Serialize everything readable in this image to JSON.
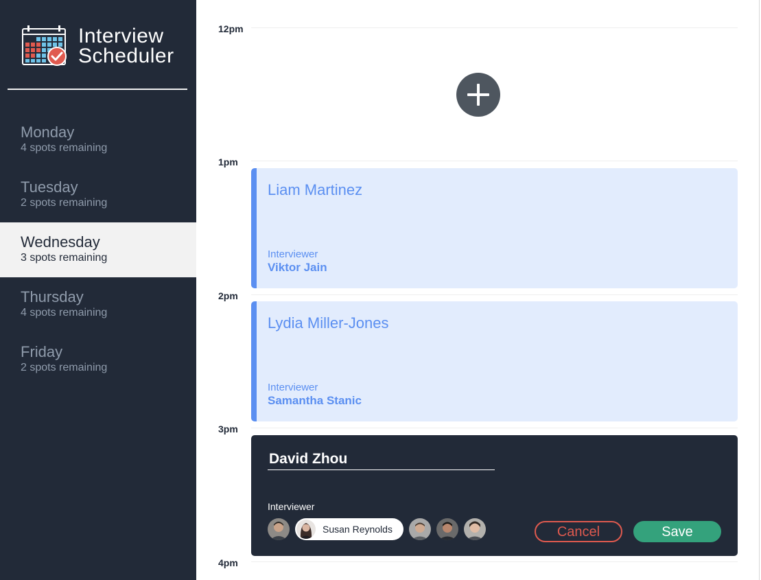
{
  "app": {
    "title_line1": "Interview",
    "title_line2": "Scheduler"
  },
  "days": [
    {
      "name": "Monday",
      "spots": "4 spots remaining",
      "selected": false
    },
    {
      "name": "Tuesday",
      "spots": "2 spots remaining",
      "selected": false
    },
    {
      "name": "Wednesday",
      "spots": "3 spots remaining",
      "selected": true
    },
    {
      "name": "Thursday",
      "spots": "4 spots remaining",
      "selected": false
    },
    {
      "name": "Friday",
      "spots": "2 spots remaining",
      "selected": false
    }
  ],
  "times": [
    "12pm",
    "1pm",
    "2pm",
    "3pm",
    "4pm"
  ],
  "appointments": [
    {
      "student": "Liam Martinez",
      "interviewer_label": "Interviewer",
      "interviewer": "Viktor Jain"
    },
    {
      "student": "Lydia Miller-Jones",
      "interviewer_label": "Interviewer",
      "interviewer": "Samantha Stanic"
    }
  ],
  "form": {
    "student_value": "David Zhou",
    "interviewer_label": "Interviewer",
    "selected_interviewer": "Susan Reynolds",
    "cancel_label": "Cancel",
    "save_label": "Save"
  },
  "colors": {
    "sidebar_bg": "#222a38",
    "accent_blue": "#5b8ff1",
    "appointment_bg": "#e2ecfd",
    "danger": "#e05a4f",
    "success": "#34a27c",
    "add_button": "#4e565f"
  },
  "icons": {
    "logo": "calendar-check-icon",
    "add": "plus-icon"
  }
}
